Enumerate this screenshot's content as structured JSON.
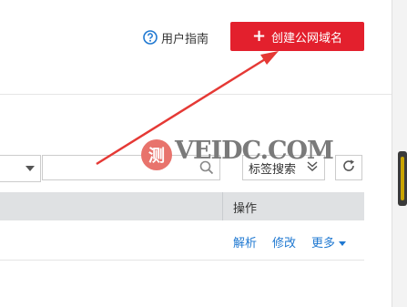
{
  "header": {
    "guide_label": "用户指南",
    "create_button_label": "创建公网域名"
  },
  "filter": {
    "search_value": "",
    "tag_search_label": "标签搜索"
  },
  "table": {
    "columns": [
      "操作"
    ],
    "row_actions": [
      "解析",
      "修改",
      "更多"
    ]
  },
  "watermark": {
    "logo_char": "测",
    "text": "VEIDC.COM"
  },
  "colors": {
    "primary_red": "#e3202d",
    "link_blue": "#1f78d1",
    "header_gray": "#dfe1e3"
  },
  "icons": [
    "help-circle-icon",
    "plus-icon",
    "chevron-down-icon",
    "search-icon",
    "double-chevron-down-icon",
    "refresh-icon",
    "caret-down-icon"
  ]
}
